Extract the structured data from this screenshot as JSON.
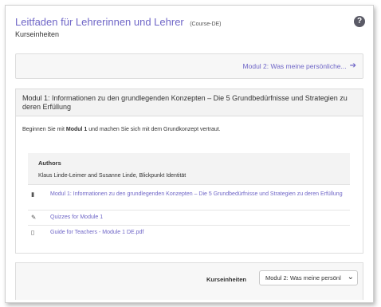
{
  "header": {
    "course_title": "Leitfaden für Lehrerinnen und Lehrer",
    "course_code": "(Course-DE)",
    "subtitle": "Kurseinheiten",
    "help_icon_glyph": "?"
  },
  "nav": {
    "next_label": "Modul 2: Was meine persönliche...",
    "next_arrow": "➔"
  },
  "module": {
    "title": "Modul 1: Informationen zu den grundlegenden Konzepten – Die 5 Grundbedürfnisse und Strategien zu deren Erfüllung",
    "intro_before": "Beginnen Sie mit ",
    "intro_bold": "Modul 1",
    "intro_after": " und machen Sie sich mit dem Grundkonzept vertraut.",
    "authors_label": "Authors",
    "authors_value": "Klaus Linde-Leimer and Susanne Linde, Blickpunkt Identität",
    "resources": [
      {
        "icon": "book-icon",
        "glyph": "▮",
        "label": "Modul 1: Informationen zu den grundlegenden Konzepten – Die 5 Grundbedürfnisse und Strategien zu deren Erfüllung"
      },
      {
        "icon": "quiz-icon",
        "glyph": "✎",
        "label": "Quizzes for Module 1"
      },
      {
        "icon": "file-icon",
        "glyph": "▯",
        "label": "Guide for Teachers - Module 1 DE.pdf"
      }
    ]
  },
  "footer": {
    "select_label": "Kurseinheiten",
    "select_value": "Modul 2: Was meine persönli",
    "chevron_glyph": "⌄"
  },
  "colors": {
    "link": "#6f66c7",
    "header_bg": "#f3f3f3"
  }
}
